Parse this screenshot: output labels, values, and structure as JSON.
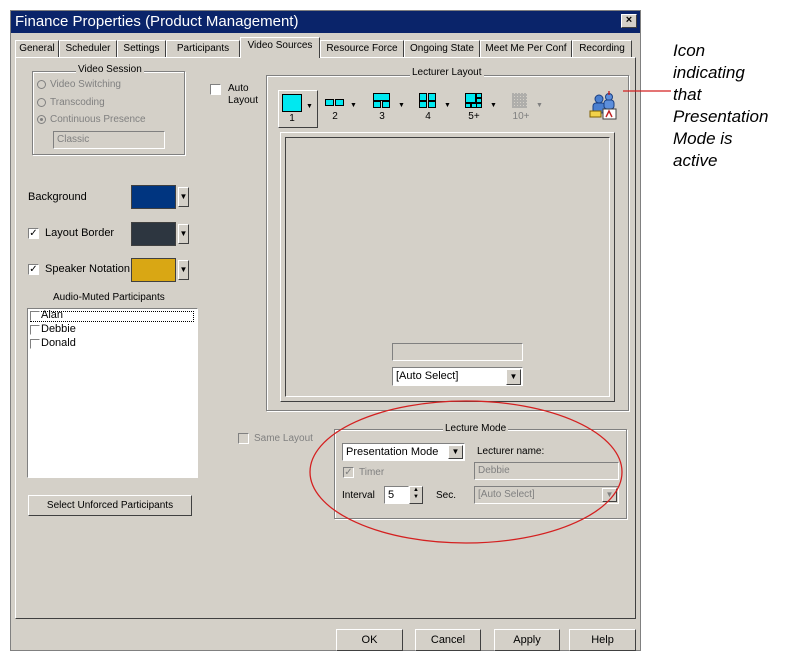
{
  "window": {
    "title": "Finance Properties  (Product Management)",
    "close_symbol": "×"
  },
  "tabs": [
    "General",
    "Scheduler",
    "Settings",
    "Participants",
    "Video Sources",
    "Resource Force",
    "Ongoing State",
    "Meet Me Per Conf",
    "Recording"
  ],
  "active_tab": "Video Sources",
  "video_session": {
    "title": "Video Session",
    "options": [
      "Video Switching",
      "Transcoding",
      "Continuous Presence"
    ],
    "selected": "Continuous Presence",
    "mode_value": "Classic"
  },
  "auto_layout": {
    "label_line1": "Auto",
    "label_line2": "Layout",
    "checked": false
  },
  "colors": {
    "background_label": "Background",
    "background_color": "#003580",
    "layout_border_label": "Layout Border",
    "layout_border_checked": true,
    "layout_border_color": "#2d3640",
    "speaker_notation_label": "Speaker Notation",
    "speaker_notation_checked": true,
    "speaker_notation_color": "#d9a714",
    "checkmark": "✓",
    "dropdown_arrow": "▼"
  },
  "muted": {
    "title": "Audio-Muted Participants",
    "participants": [
      "Alan",
      "Debbie",
      "Donald"
    ]
  },
  "select_unforced_button": "Select Unforced Participants",
  "lecturer_layout": {
    "title": "Lecturer Layout",
    "layout_labels": [
      "1",
      "2",
      "3",
      "4",
      "5+",
      "10+"
    ],
    "preview_value": "",
    "auto_select_value": "[Auto Select]"
  },
  "same_layout": {
    "label": "Same Layout",
    "checked": false
  },
  "lecture_mode": {
    "title": "Lecture Mode",
    "mode_value": "Presentation Mode",
    "lecturer_name_label": "Lecturer name:",
    "lecturer_name_value": "Debbie",
    "timer_label": "Timer",
    "timer_checked": true,
    "interval_label": "Interval",
    "interval_value": "5",
    "sec_label": "Sec.",
    "auto_select_value": "[Auto Select]"
  },
  "buttons": {
    "ok": "OK",
    "cancel": "Cancel",
    "apply": "Apply",
    "help": "Help"
  },
  "annotation": {
    "lines": [
      "Icon",
      "indicating",
      "that",
      "Presentation",
      "Mode is",
      "active"
    ]
  }
}
